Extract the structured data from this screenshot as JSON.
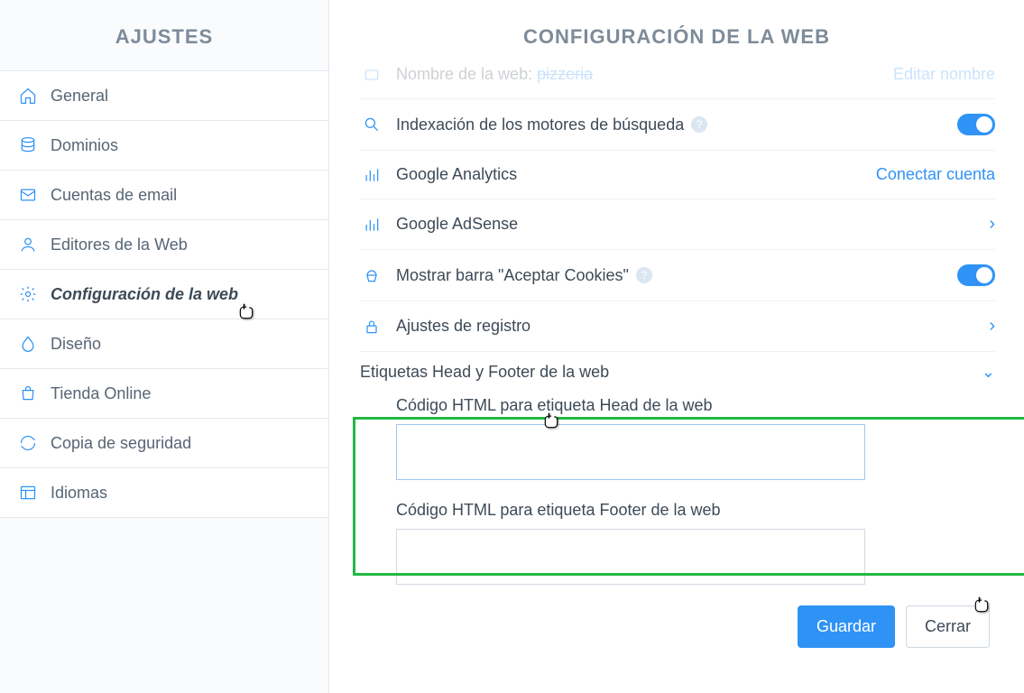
{
  "sidebar": {
    "title": "AJUSTES",
    "items": [
      {
        "label": "General"
      },
      {
        "label": "Dominios"
      },
      {
        "label": "Cuentas de email"
      },
      {
        "label": "Editores de la Web"
      },
      {
        "label": "Configuración de la web"
      },
      {
        "label": "Diseño"
      },
      {
        "label": "Tienda Online"
      },
      {
        "label": "Copia de seguridad"
      },
      {
        "label": "Idiomas"
      }
    ]
  },
  "main": {
    "title": "CONFIGURACIÓN DE LA WEB",
    "rows": {
      "site_name_label": "Nombre de la web:",
      "site_name_value": "pizzeria",
      "site_name_action": "Editar nombre",
      "indexing": "Indexación de los motores de búsqueda",
      "ga": "Google Analytics",
      "ga_action": "Conectar cuenta",
      "adsense": "Google AdSense",
      "cookies": "Mostrar barra \"Aceptar Cookies\"",
      "registro": "Ajustes de registro",
      "headfooter": "Etiquetas Head y Footer de la web"
    },
    "form": {
      "head_label": "Código HTML para etiqueta Head de la web",
      "head_value": "",
      "footer_label": "Código HTML para etiqueta Footer de la web",
      "footer_value": "",
      "save": "Guardar",
      "close": "Cerrar"
    }
  }
}
